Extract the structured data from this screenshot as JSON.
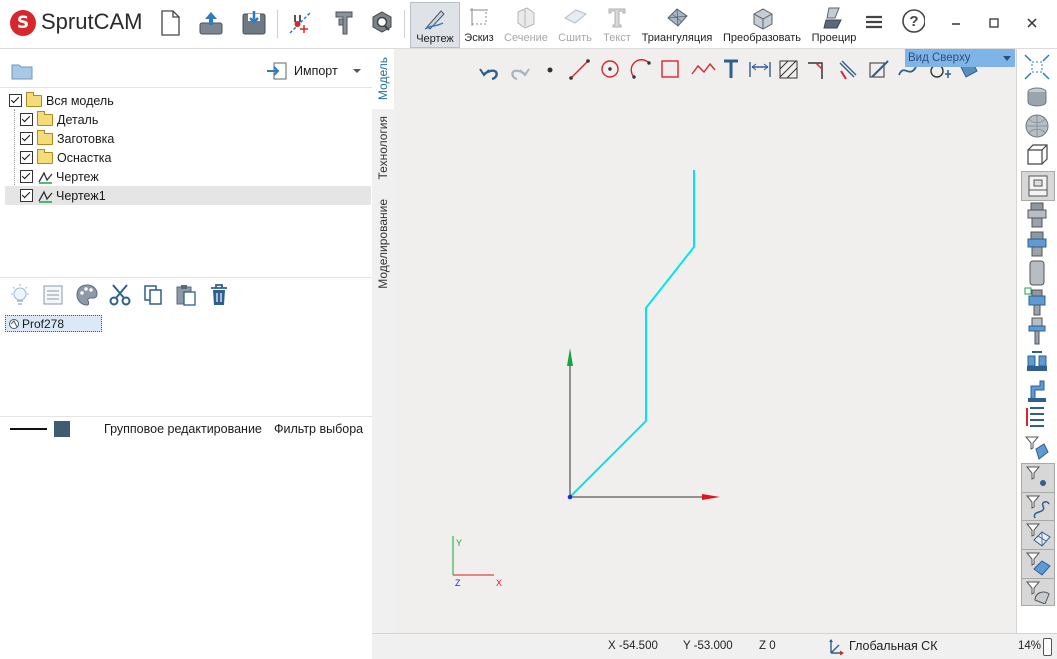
{
  "app": {
    "logo_letter": "S",
    "name": "SprutCAM"
  },
  "mode_buttons": [
    {
      "label": "Чертеж",
      "state": "active"
    },
    {
      "label": "Эскиз",
      "state": "normal"
    },
    {
      "label": "Сечение",
      "state": "disabled"
    },
    {
      "label": "Сшить",
      "state": "disabled"
    },
    {
      "label": "Текст",
      "state": "disabled"
    },
    {
      "label": "Триангуляция",
      "state": "normal"
    },
    {
      "label": "Преобразовать",
      "state": "normal"
    },
    {
      "label": "Проецир",
      "state": "normal"
    }
  ],
  "left_panel": {
    "import_label": "Импорт",
    "tree": [
      {
        "label": "Вся модель",
        "type": "folder",
        "checked": true
      },
      {
        "label": "Деталь",
        "type": "folder",
        "checked": true
      },
      {
        "label": "Заготовка",
        "type": "folder",
        "checked": true
      },
      {
        "label": "Оснастка",
        "type": "folder",
        "checked": true
      },
      {
        "label": "Чертеж",
        "type": "sketch",
        "checked": true
      },
      {
        "label": "Чертеж1",
        "type": "sketch",
        "checked": true,
        "selected": true
      }
    ],
    "object_list": [
      {
        "label": "Prof278"
      }
    ],
    "group_edit_label": "Групповое редактирование",
    "filter_label": "Фильтр выбора"
  },
  "vertical_tabs": [
    {
      "label": "Модель",
      "active": true
    },
    {
      "label": "Технология",
      "active": false
    },
    {
      "label": "Моделирование",
      "active": false
    }
  ],
  "viewport": {
    "view_selector": "Вид Сверху",
    "axis_labels": {
      "x": "X",
      "y": "Y",
      "z": "Z"
    },
    "colors": {
      "profile": "#00e5ee",
      "x_axis": "#e0141a",
      "y_axis": "#12a63c",
      "background": "#f0efee"
    }
  },
  "status": {
    "x": "X -54.500",
    "y": "Y -53.000",
    "z": "Z 0",
    "cs_label": "Глобальная СК",
    "zoom": "14%"
  }
}
